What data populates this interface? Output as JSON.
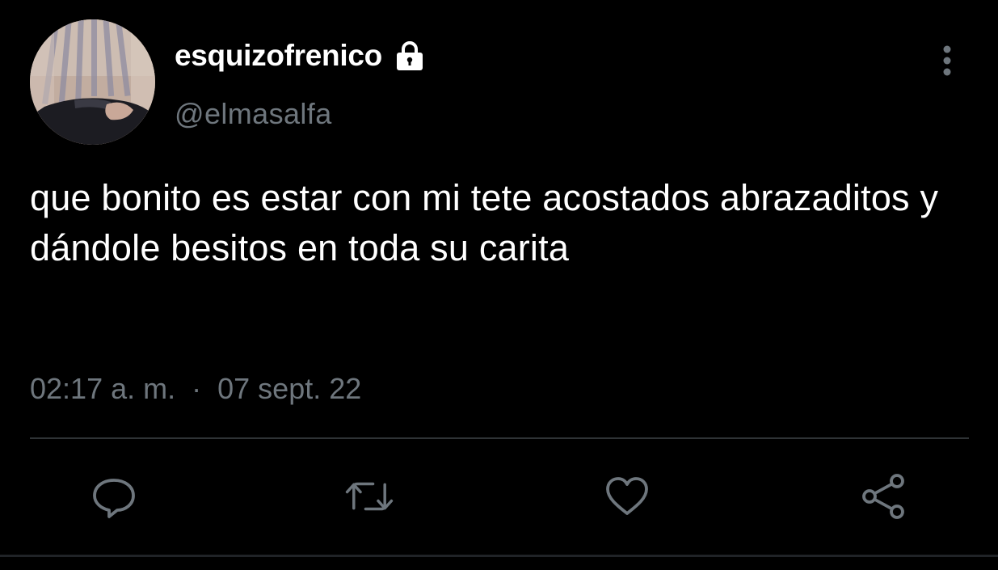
{
  "user": {
    "display_name": "esquizofrenico",
    "handle": "@elmasalfa",
    "protected_icon": "lock-icon"
  },
  "tweet": {
    "text": "que bonito es estar con mi tete acostados abrazaditos y dándole besitos en toda su carita",
    "time": "02:17 a. m.",
    "separator": "·",
    "date": "07 sept. 22"
  },
  "actions": [
    {
      "icon": "reply-icon"
    },
    {
      "icon": "retweet-icon"
    },
    {
      "icon": "like-icon"
    },
    {
      "icon": "share-icon"
    }
  ],
  "colors": {
    "background": "#000000",
    "primary_text": "#ffffff",
    "secondary_text": "#6e767d",
    "divider": "#2f3336"
  }
}
